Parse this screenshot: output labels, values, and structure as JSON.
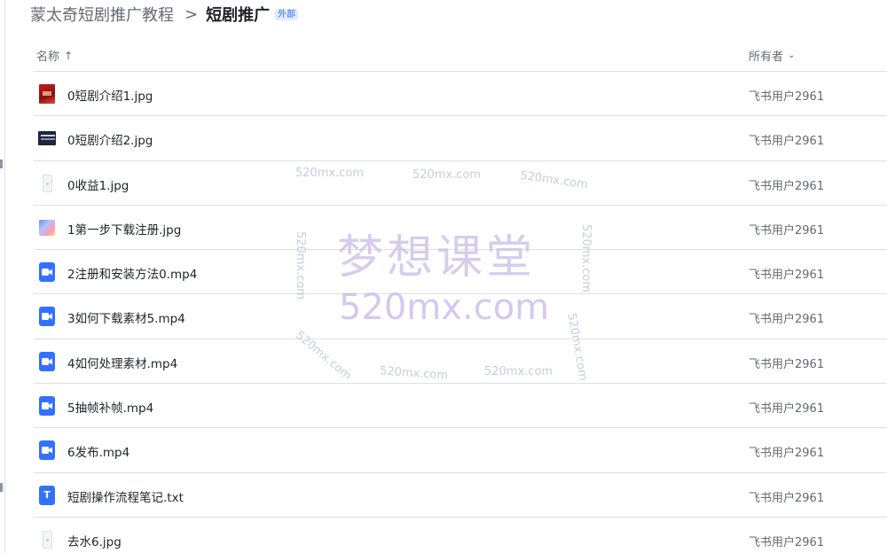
{
  "breadcrumb": {
    "root": "蒙太奇短剧推广教程",
    "separator": ">",
    "current": "短剧推广",
    "tag": "外部"
  },
  "columns": {
    "name": "名称",
    "name_sort_icon": "arrow-up-icon",
    "owner": "所有者",
    "owner_menu_icon": "chevron-down-icon"
  },
  "files": [
    {
      "name": "0短剧介绍1.jpg",
      "owner": "飞书用户2961",
      "icon": "image-thumbnail-red"
    },
    {
      "name": "0短剧介绍2.jpg",
      "owner": "飞书用户2961",
      "icon": "image-thumbnail-dark"
    },
    {
      "name": "0收益1.jpg",
      "owner": "飞书用户2961",
      "icon": "image-thumbnail-phone"
    },
    {
      "name": "1第一步下载注册.jpg",
      "owner": "飞书用户2961",
      "icon": "image-thumbnail-colorful"
    },
    {
      "name": "2注册和安装方法0.mp4",
      "owner": "飞书用户2961",
      "icon": "video-file-icon"
    },
    {
      "name": "3如何下载素材5.mp4",
      "owner": "飞书用户2961",
      "icon": "video-file-icon"
    },
    {
      "name": "4如何处理素材.mp4",
      "owner": "飞书用户2961",
      "icon": "video-file-icon"
    },
    {
      "name": "5抽帧补帧.mp4",
      "owner": "飞书用户2961",
      "icon": "video-file-icon"
    },
    {
      "name": "6发布.mp4",
      "owner": "飞书用户2961",
      "icon": "video-file-icon"
    },
    {
      "name": "短剧操作流程笔记.txt",
      "owner": "飞书用户2961",
      "icon": "text-file-icon"
    },
    {
      "name": "去水6.jpg",
      "owner": "飞书用户2961",
      "icon": "image-thumbnail-phone"
    }
  ],
  "watermark": {
    "title": "梦想课堂",
    "domain": "520mx.com"
  },
  "colors": {
    "accent": "#3370ff",
    "text_primary": "#1f2329",
    "text_secondary": "#646a73",
    "divider": "#dee0e3"
  }
}
